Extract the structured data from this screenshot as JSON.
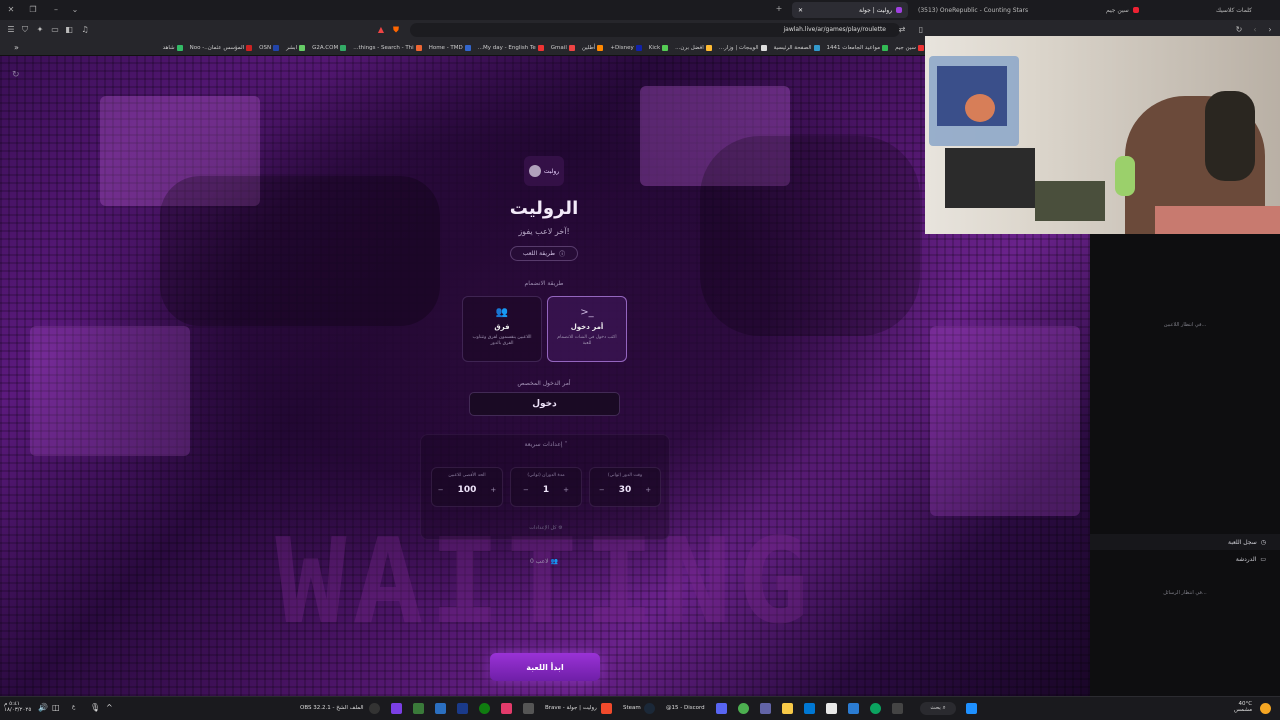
{
  "browser": {
    "tabs": [
      {
        "label": "روليت | جولة",
        "active": true
      },
      {
        "label": "(3513) OneRepublic - Counting Stars",
        "active": false
      },
      {
        "label": "سين جيم",
        "active": false
      },
      {
        "label": "كلمات كلاسيك",
        "active": false
      }
    ],
    "url": "jawlah.live/ar/games/play/roulette",
    "bookmarks": [
      "شاهد",
      "المؤسس عثمان..- Noo",
      "OSN",
      "ابشر",
      "G2A.COM",
      "things - Search - Thi...",
      "Home - TMD",
      "My day - English Te...",
      "Gmail",
      "أطلين",
      "Disney+",
      "Kick",
      "افضل برن...",
      "الويبجات | وزار...",
      "الصفحة الرئيسية",
      "مواعيد الجامعات 1441",
      "سين جيم"
    ]
  },
  "game": {
    "logo_text": "رولبت",
    "title": "الروليت",
    "subtitle": "آخر لاعب يفوز!",
    "how_to_play": "طريقة اللعب",
    "join_method_label": "طريقة الانضمام",
    "modes": [
      {
        "name": "أمر دخول",
        "icon": ">_",
        "desc": "اكتب دخول في الشات للانضمام للعبة",
        "selected": true
      },
      {
        "name": "فرق",
        "icon": "👥",
        "desc": "اللاعبين ينقسمون لفرق وتتناوب الفرق بالدور",
        "selected": false
      }
    ],
    "custom_cmd_label": "أمر الدخول المخصص",
    "custom_cmd_value": "دخول",
    "quick_settings_title": "إعدادات سريعة",
    "quick_settings": [
      {
        "label": "وقت الدور (ثواني)",
        "value": "30"
      },
      {
        "label": "مدة الدوران (ثواني)",
        "value": "1"
      },
      {
        "label": "الحد الأقصى للاعبين",
        "value": "100"
      }
    ],
    "all_settings": "كل الإعدادات",
    "players_count": "0 لاعب",
    "start_button": "ابدأ اللعبة",
    "background_text": "WAITING"
  },
  "side_panel": {
    "waiting_players": "في انتظار اللاعبين...",
    "items": [
      {
        "label": "سجل اللعبة",
        "active": true
      },
      {
        "label": "الدردشة",
        "active": false
      }
    ],
    "waiting_messages": "في انتظار الرسائل..."
  },
  "taskbar": {
    "obs": "OBS 32.2.1 - الملف الشخ",
    "brave": "Brave - روليت | جولة",
    "steam": "Steam",
    "discord": "@15 - Discord",
    "search": "بحث",
    "temp": "40°C",
    "weather": "مشمس",
    "time": "٥:٤١ م",
    "date": "١٨/٠٣/٢٠٢٥"
  },
  "colors": {
    "accent": "#8a2bd0",
    "background": "#0b0610"
  }
}
